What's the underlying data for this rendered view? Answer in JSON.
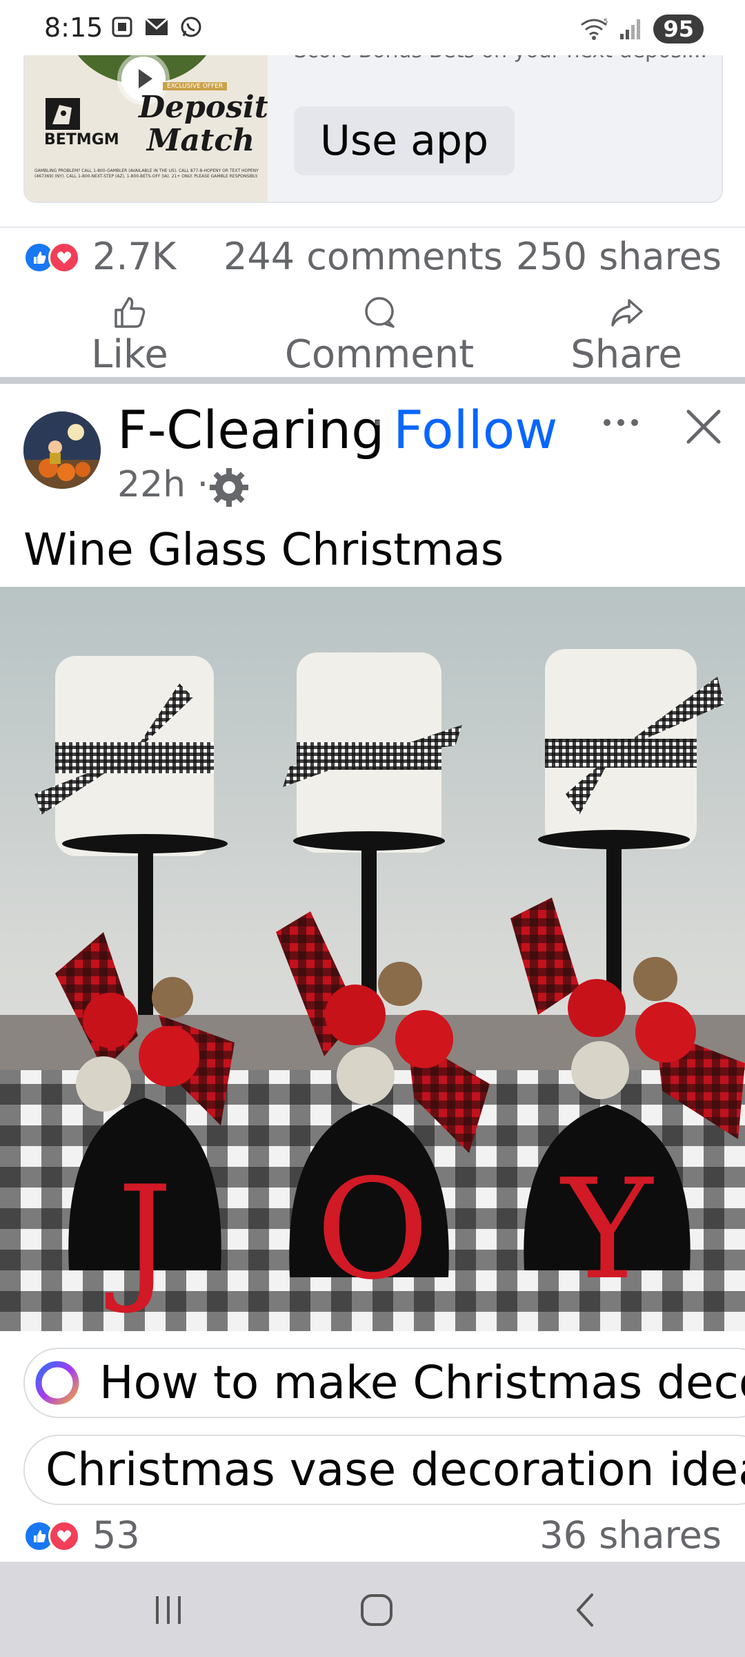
{
  "status_bar": {
    "time": "8:15",
    "battery": "95",
    "network": "5"
  },
  "ad": {
    "headline": "Score Bonus Bets on your next deposi...",
    "badge": "EXCLUSIVE OFFER",
    "offer_line1": "Deposit",
    "offer_line2": "Match",
    "brand": "BETMGM",
    "fine_print": "GAMBLING PROBLEM? CALL 1-800-GAMBLER (AVAILABLE IN THE US). CALL 877-8-HOPENY OR TEXT HOPENY (467369) (NY). CALL 1-800-NEXT-STEP (AZ), 1-800-BETS-OFF (IA). 21+ ONLY. PLEASE GAMBLE RESPONSIBLY.",
    "cta": "Use app"
  },
  "post1_stats": {
    "reactions": "2.7K",
    "comments": "244 comments",
    "shares": "250 shares"
  },
  "actions": {
    "like": "Like",
    "comment": "Comment",
    "share": "Share"
  },
  "post2": {
    "page_name": "F-Clearing",
    "dot": "·",
    "follow": "Follow",
    "time": "22h ·",
    "text": "Wine Glass Christmas",
    "photo_letters": [
      "J",
      "O",
      "Y"
    ]
  },
  "related": {
    "chip1": "How to make Christmas decor",
    "chip2": "Christmas vase decoration ideas"
  },
  "post2_stats": {
    "reactions": "53",
    "shares": "36 shares"
  },
  "colors": {
    "facebook_blue": "#0866ff",
    "like_blue": "#1877f2",
    "love_red": "#f33e58",
    "secondary_text": "#65676b"
  }
}
